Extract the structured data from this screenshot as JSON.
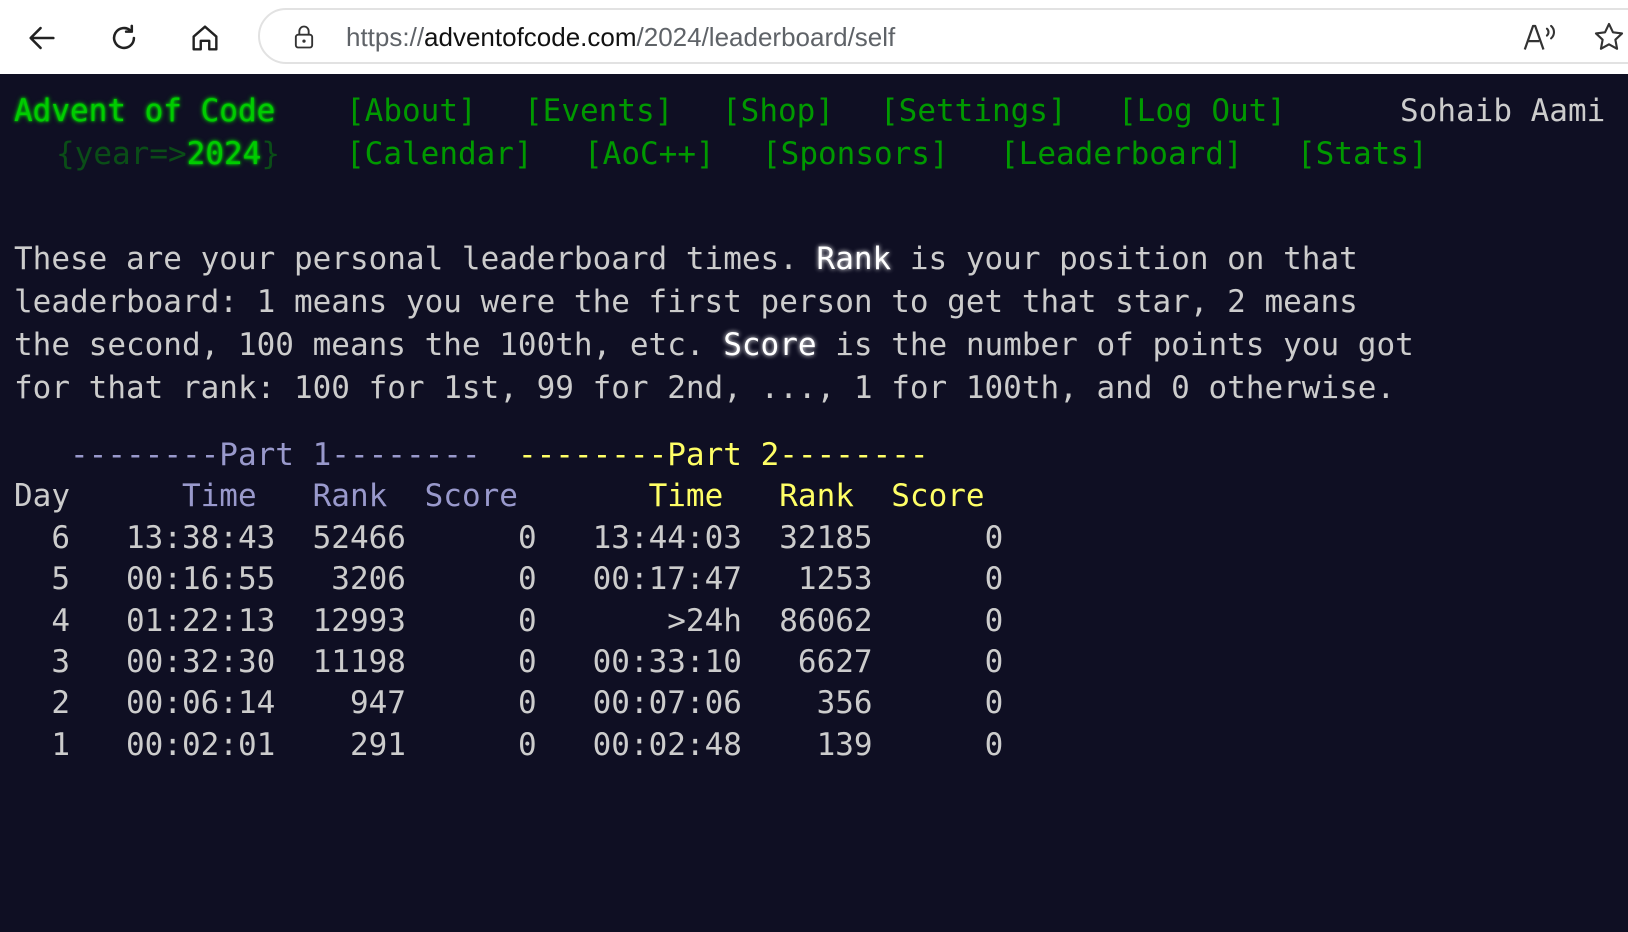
{
  "browser": {
    "url_prefix": "https://",
    "url_host": "adventofcode.com",
    "url_path": "/2024/leaderboard/self",
    "icons": [
      "back-arrow-icon",
      "refresh-icon",
      "home-icon",
      "lock-icon",
      "read-aloud-icon",
      "favorite-star-icon"
    ]
  },
  "header": {
    "logo": "Advent of Code",
    "year_prefix": "{year=>",
    "year_value": "2024",
    "year_suffix": "}",
    "user": "Sohaib Aami",
    "nav_row1": [
      "[About]",
      "[Events]",
      "[Shop]",
      "[Settings]",
      "[Log Out]"
    ],
    "nav_row2": [
      "[Calendar]",
      "[AoC++]",
      "[Sponsors]",
      "[Leaderboard]",
      "[Stats]"
    ]
  },
  "intro": {
    "p1": "These are your personal leaderboard times. ",
    "rank_word": "Rank",
    "p2": " is your position on that\nleaderboard: 1 means you were the first person to get that star, 2 means\nthe second, 100 means the 100th, etc. ",
    "score_word": "Score",
    "p3": " is the number of points you got\nfor that rank: 100 for 1st, 99 for 2nd, ..., 1 for 100th, and 0 otherwise."
  },
  "table": {
    "part1_header": "--------Part 1--------",
    "part2_header": "--------Part 2--------",
    "col_day": "Day",
    "col_time": "Time",
    "col_rank": "Rank",
    "col_score": "Score",
    "rows": [
      {
        "day": "6",
        "t1": "13:38:43",
        "r1": "52466",
        "s1": "0",
        "t2": "13:44:03",
        "r2": "32185",
        "s2": "0"
      },
      {
        "day": "5",
        "t1": "00:16:55",
        "r1": "3206",
        "s1": "0",
        "t2": "00:17:47",
        "r2": "1253",
        "s2": "0"
      },
      {
        "day": "4",
        "t1": "01:22:13",
        "r1": "12993",
        "s1": "0",
        "t2": ">24h",
        "r2": "86062",
        "s2": "0"
      },
      {
        "day": "3",
        "t1": "00:32:30",
        "r1": "11198",
        "s1": "0",
        "t2": "00:33:10",
        "r2": "6627",
        "s2": "0"
      },
      {
        "day": "2",
        "t1": "00:06:14",
        "r1": "947",
        "s1": "0",
        "t2": "00:07:06",
        "r2": "356",
        "s2": "0"
      },
      {
        "day": "1",
        "t1": "00:02:01",
        "r1": "291",
        "s1": "0",
        "t2": "00:02:48",
        "r2": "139",
        "s2": "0"
      }
    ]
  },
  "colors": {
    "background": "#0f0f23",
    "text": "#cccccc",
    "logo_green": "#00cc00",
    "link_green": "#009900",
    "part1": "#9999cc",
    "part2": "#ffff66"
  }
}
